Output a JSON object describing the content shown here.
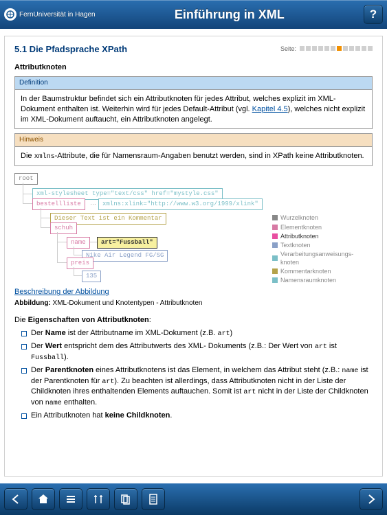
{
  "header": {
    "brand": "FernUniversität in Hagen",
    "title": "Einführung in XML",
    "help_label": "?"
  },
  "page": {
    "heading": "5.1 Die Pfadsprache XPath",
    "page_label": "Seite:",
    "page_total": 12,
    "page_current": 7,
    "subheading": "Attributknoten",
    "definition": {
      "title": "Definition",
      "body_1": "In der Baumstruktur befindet sich ein Attributknoten für jedes Attribut, welches explizit im XML-Dokument enthalten ist. Weiterhin wird für jedes Default-Attribut (vgl. ",
      "link": "Kapitel 4.5",
      "body_2": "), welches nicht explizit im XML-Dokument auftaucht, ein Attributknoten angelegt."
    },
    "hint": {
      "title": "Hinweis",
      "body_1": "Die ",
      "code": "xmlns",
      "body_2": "-Attribute, die für Namensraum-Angaben benutzt werden, sind in XPath keine Attributknoten."
    },
    "diagram": {
      "root": "root",
      "pi": "xml-stylesheet type=\"text/css\" href=\"mystyle.css\"",
      "bestellliste": "bestellliste",
      "ns_ellipsis": "…",
      "ns": "xmlns:xlink=\"http://www.w3.org/1999/xlink\"",
      "comment": "Dieser Text ist ein Kommentar",
      "schuh": "schuh",
      "name": "name",
      "attr": "art=\"Fussball\"",
      "text1": "Nike Air Legend FG/SG",
      "preis": "preis",
      "text2": "135",
      "legend": {
        "wurzel": "Wurzelknoten",
        "element": "Elementknoten",
        "attribut": "Attributknoten",
        "text": "Textknoten",
        "pi": "Verarbeitungsanweisungs-knoten",
        "kommentar": "Kommentarknoten",
        "ns": "Namensraumknoten"
      },
      "fig_link": "Beschreibung der Abbildung",
      "fig_caption_prefix": "Abbildung:",
      "fig_caption": " XML-Dokument und Knotentypen - Attributknoten"
    },
    "properties": {
      "intro_1": "Die ",
      "intro_bold": "Eigenschaften von Attributknoten",
      "intro_2": ":",
      "items": [
        {
          "pre": "Der ",
          "b": "Name",
          "post": " ist der Attributname im XML-Dokument (z.B. ",
          "code": "art",
          "tail": ")"
        },
        {
          "pre": "Der ",
          "b": "Wert",
          "post": " entspricht dem des Attributwerts des XML- Dokuments (z.B.: Der Wert von ",
          "code": "art",
          "mid": " ist ",
          "code2": "Fussball",
          "tail": ")."
        },
        {
          "pre": "Der ",
          "b": "Parentknoten",
          "post": " eines Attributknotens ist das Element, in welchem das Attribut steht (z.B.: ",
          "code": "name",
          "mid": " ist der Parentknoten für ",
          "code2": "art",
          "post2": "). Zu beachten ist allerdings, dass Attributknoten nicht in der Liste der Childknoten ihres enthaltenden Elements auftauchen. Somit ist ",
          "code3": "art",
          "post3": " nicht in der Liste der Childknoten von ",
          "code4": "name",
          "tail": " enthalten."
        },
        {
          "pre": "Ein Attributknoten hat ",
          "b": "keine Childknoten",
          "post": "."
        }
      ]
    }
  },
  "bottombar": {
    "prev": "prev",
    "home": "home",
    "toc": "toc",
    "tools": "tools",
    "pages": "pages",
    "doc": "doc",
    "next": "next"
  }
}
